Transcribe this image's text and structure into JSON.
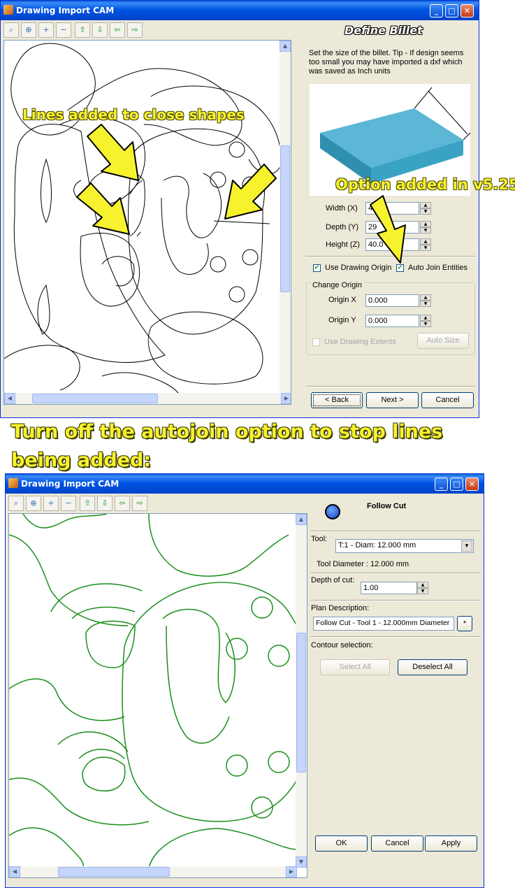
{
  "window1": {
    "title": "Drawing Import CAM",
    "panel_title": "Define Billet",
    "instructions": "Set the size of the billet. Tip - If design seems too small you may have imported a dxf which was saved as Inch units",
    "fields": {
      "width_label": "Width (X)",
      "width_value": "4",
      "depth_label": "Depth (Y)",
      "depth_value": "29",
      "height_label": "Height (Z)",
      "height_value": "40.0"
    },
    "use_drawing_origin": "Use Drawing Origin",
    "auto_join": "Auto Join Entities",
    "change_origin": "Change Origin",
    "origin_x_label": "Origin X",
    "origin_x": "0.000",
    "origin_y_label": "Origin Y",
    "origin_y": "0.000",
    "use_drawing_extents": "Use Drawing Extents",
    "auto_size": "Auto Size",
    "back": "< Back",
    "next": "Next >",
    "cancel": "Cancel"
  },
  "annotations": {
    "lines_added": "Lines added to close shapes",
    "option_added": "Option added in v5.25",
    "instruction_line1": "Turn off the autojoin option to stop lines",
    "instruction_line2": "being added:"
  },
  "window2": {
    "title": "Drawing Import CAM",
    "heading": "Follow Cut",
    "tool_label": "Tool:",
    "tool_value": "T:1 - Diam: 12.000 mm",
    "tool_diameter": "Tool Diameter : 12.000 mm",
    "depth_label": "Depth of cut:",
    "depth_value": "1.00",
    "plan_label": "Plan Description:",
    "plan_value": "Follow Cut - Tool 1 - 12.000mm Diameter",
    "star_button": "*",
    "contour_label": "Contour selection:",
    "select_all": "Select All",
    "deselect_all": "Deselect All",
    "ok": "OK",
    "cancel": "Cancel",
    "apply": "Apply"
  },
  "colors": {
    "accent": "#0054e3",
    "annotation": "#f7f22e",
    "green_path": "#1a8f1a",
    "billet": "#3e9fbd"
  }
}
